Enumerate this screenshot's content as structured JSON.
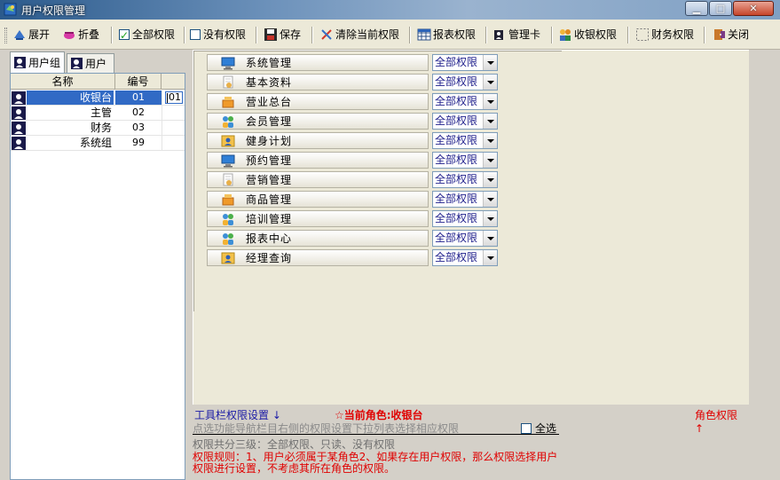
{
  "window": {
    "title": "用户权限管理",
    "min_glyph": "▁",
    "max_glyph": "□",
    "close_glyph": "✕"
  },
  "toolbar": {
    "expand": "展开",
    "collapse": "折叠",
    "all_perm": "全部权限",
    "no_perm": "没有权限",
    "save": "保存",
    "clear_current": "清除当前权限",
    "report_perm": "报表权限",
    "mgmt_card": "管理卡",
    "cashier_perm": "收银权限",
    "finance_perm": "财务权限",
    "close": "关闭",
    "all_perm_checked": true,
    "no_perm_checked": false
  },
  "left": {
    "tabs": [
      "用户组",
      "用户"
    ],
    "columns": {
      "name": "名称",
      "code": "编号"
    },
    "rows": [
      {
        "name": "收银台",
        "code": "01",
        "edit": "01",
        "selected": true
      },
      {
        "name": "主管",
        "code": "02"
      },
      {
        "name": "财务",
        "code": "03"
      },
      {
        "name": "系统组",
        "code": "99"
      }
    ]
  },
  "functions": [
    {
      "label": "系统管理",
      "icon": "monitor-icon",
      "perm": "全部权限"
    },
    {
      "label": "基本资料",
      "icon": "document-hand-icon",
      "perm": "全部权限"
    },
    {
      "label": "营业总台",
      "icon": "cash-register-icon",
      "perm": "全部权限"
    },
    {
      "label": "会员管理",
      "icon": "people-icon",
      "perm": "全部权限"
    },
    {
      "label": "健身计划",
      "icon": "contact-card-icon",
      "perm": "全部权限"
    },
    {
      "label": "预约管理",
      "icon": "monitor-icon",
      "perm": "全部权限"
    },
    {
      "label": "营销管理",
      "icon": "document-hand-icon",
      "perm": "全部权限"
    },
    {
      "label": "商品管理",
      "icon": "cash-register-icon",
      "perm": "全部权限"
    },
    {
      "label": "培训管理",
      "icon": "people-icon",
      "perm": "全部权限"
    },
    {
      "label": "报表中心",
      "icon": "people-icon",
      "perm": "全部权限"
    },
    {
      "label": "经理查询",
      "icon": "contact-card-icon",
      "perm": "全部权限"
    }
  ],
  "bottom": {
    "toolbar_perm_setting": "工具栏权限设置 ↓",
    "current_role": "☆当前角色:收银台",
    "role_perm": "角色权限 ↑",
    "hint1": "点选功能导航栏目右侧的权限设置下拉列表选择相应权限",
    "select_all": "全选",
    "hint2": "权限共分三级：全部权限、只读、没有权限",
    "rule_line1": "权限规则：1、用户必须属于某角色2、如果存在用户权限，那么权限选择用户",
    "rule_line2": "权限进行设置，不考虑其所在角色的权限。"
  }
}
